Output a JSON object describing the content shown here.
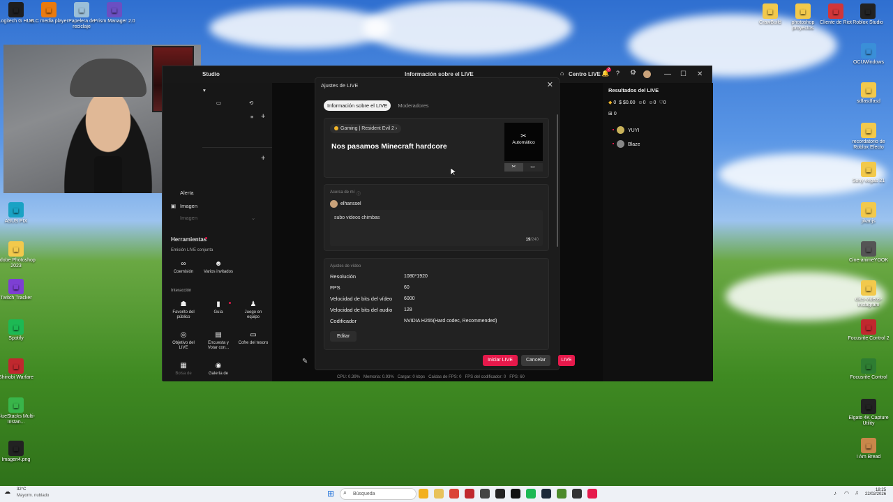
{
  "desktop": {
    "left_icons": [
      {
        "label": "Logitech G HUB",
        "icon": "logitech-icon",
        "color": "#1e1e1e"
      },
      {
        "label": "VLC media player",
        "icon": "vlc-icon",
        "color": "#e97a0f"
      },
      {
        "label": "Papelera de reciclaje",
        "icon": "recycle-bin-icon",
        "color": "#9bbfd8"
      },
      {
        "label": "Prism Manager 2.0",
        "icon": "prism-icon",
        "color": "#6b4fc2"
      }
    ],
    "left_column": [
      {
        "label": "ASUS PIX",
        "icon": "asus-icon",
        "color": "#1aa2c4"
      },
      {
        "label": "Adobe Photoshop 2023",
        "icon": "folder-icon",
        "color": "#f2c94c"
      },
      {
        "label": "Twitch Tracker",
        "icon": "twitch-icon",
        "color": "#7d3fd3"
      },
      {
        "label": "Spotify",
        "icon": "spotify-icon",
        "color": "#1db954"
      },
      {
        "label": "Shinobi Warfare",
        "icon": "shinobi-icon",
        "color": "#c0282e"
      },
      {
        "label": "BlueStacks Multi-Instan...",
        "icon": "bluestacks-icon",
        "color": "#39b54a"
      },
      {
        "label": "Imagen4.png",
        "icon": "image-file-icon",
        "color": "#222222"
      }
    ],
    "right_top_icons": [
      {
        "label": "CrawBuild",
        "icon": "folder-icon",
        "color": "#f2c94c"
      },
      {
        "label": "photoshop proyectos",
        "icon": "folder-icon",
        "color": "#f2c94c"
      },
      {
        "label": "Cliente de Riot",
        "icon": "riot-icon",
        "color": "#d13639"
      },
      {
        "label": "Roblox Studio",
        "icon": "roblox-icon",
        "color": "#222222"
      }
    ],
    "right_column": [
      {
        "label": "OCUWindows",
        "icon": "folder-icon",
        "color": "#3a8fd8"
      },
      {
        "label": "sdfasdfasd",
        "icon": "folder-icon",
        "color": "#f2c94c"
      },
      {
        "label": "recordatorio de Roblox Efecto",
        "icon": "folder-icon",
        "color": "#f2c94c"
      },
      {
        "label": "Sony vegas 21",
        "icon": "folder-icon",
        "color": "#f2c94c"
      },
      {
        "label": "jikanjs",
        "icon": "folder-icon",
        "color": "#f2c94c"
      },
      {
        "label": "Cine-animeYOOK",
        "icon": "cine-icon",
        "color": "#555555"
      },
      {
        "label": "clics-videos-instagram",
        "icon": "folder-icon",
        "color": "#f2c94c"
      },
      {
        "label": "Focusrite Control 2",
        "icon": "focusrite-icon",
        "color": "#c0282e"
      },
      {
        "label": "Focusrite Control",
        "icon": "focusrite-icon",
        "color": "#2e7d32"
      },
      {
        "label": "Elgato 4K Capture Utility",
        "icon": "elgato-icon",
        "color": "#222222"
      },
      {
        "label": "I Am Bread",
        "icon": "bread-icon",
        "color": "#c9874a"
      }
    ]
  },
  "app": {
    "title": "Studio",
    "center_title": "Información sobre el LIVE",
    "header_link": "Centro LIVE",
    "notif_count": "2",
    "left": {
      "row_imagen": "Imagen",
      "row_imagen_disabled": "Imagen",
      "row_alerta": "Alerta",
      "tools_title": "Herramientas",
      "section_joint": "Emisión LIVE conjunta",
      "section_interaction": "Interacción",
      "tools_joint": [
        {
          "label": "Coemisión",
          "icon": "link-icon"
        },
        {
          "label": "Varios invitados",
          "icon": "guests-icon"
        }
      ],
      "tools_interaction": [
        {
          "label": "Favorito del público",
          "icon": "favorite-icon"
        },
        {
          "label": "Guía",
          "icon": "guide-icon"
        },
        {
          "label": "Juego en equipo",
          "icon": "team-game-icon"
        },
        {
          "label": "Objetivo del LIVE",
          "icon": "goal-icon"
        },
        {
          "label": "Encuesta y Votar con...",
          "icon": "poll-icon"
        },
        {
          "label": "Cofre del tesoro",
          "icon": "chest-icon"
        },
        {
          "label": "Bolsa de",
          "icon": "bag-icon"
        },
        {
          "label": "Galería de",
          "icon": "gallery-icon"
        }
      ]
    },
    "right": {
      "title": "Resultados del LIVE",
      "stats": [
        "0",
        "$0.00",
        "0",
        "0",
        "0"
      ],
      "stat2": "0",
      "users": [
        "YUYI",
        "Blaze"
      ]
    },
    "status": {
      "cpu": "CPU: 0.39%",
      "mem": "Memoria: 0.93%",
      "load": "Cargar: 0 kbps",
      "fps_drop": "Caídas de FPS: 0",
      "enc_drop": "FPS del codificador: 0",
      "fps": "FPS: 60"
    }
  },
  "modal": {
    "title": "Ajustes de LIVE",
    "tabs": [
      "Información sobre el LIVE",
      "Moderadores"
    ],
    "category": "Gaming | Resident Evil 2",
    "stream_title": "Nos pasamos Minecraft hardcore",
    "thumb_label": "Automático",
    "about_label": "Acerca de mí",
    "username": "elhanssel",
    "description": "subo videos chimbas",
    "char_count": "19",
    "char_max": "/240",
    "video_label": "Ajustes de vídeo",
    "video": [
      {
        "k": "Resolución",
        "v": "1080*1920"
      },
      {
        "k": "FPS",
        "v": "60"
      },
      {
        "k": "Velocidad de bits del vídeo",
        "v": "6000"
      },
      {
        "k": "Velocidad de bits del audio",
        "v": "128"
      },
      {
        "k": "Codificador",
        "v": "NVIDIA H265(Hard codec, Recommended)"
      }
    ],
    "edit": "Editar",
    "start": "Iniciar LIVE",
    "cancel": "Cancelar",
    "live": "LIVE"
  },
  "taskbar": {
    "weather_temp": "32°C",
    "weather_desc": "Mayorm. nublado",
    "search_placeholder": "Búsqueda",
    "time": "18:25",
    "date": "22/02/2026"
  }
}
